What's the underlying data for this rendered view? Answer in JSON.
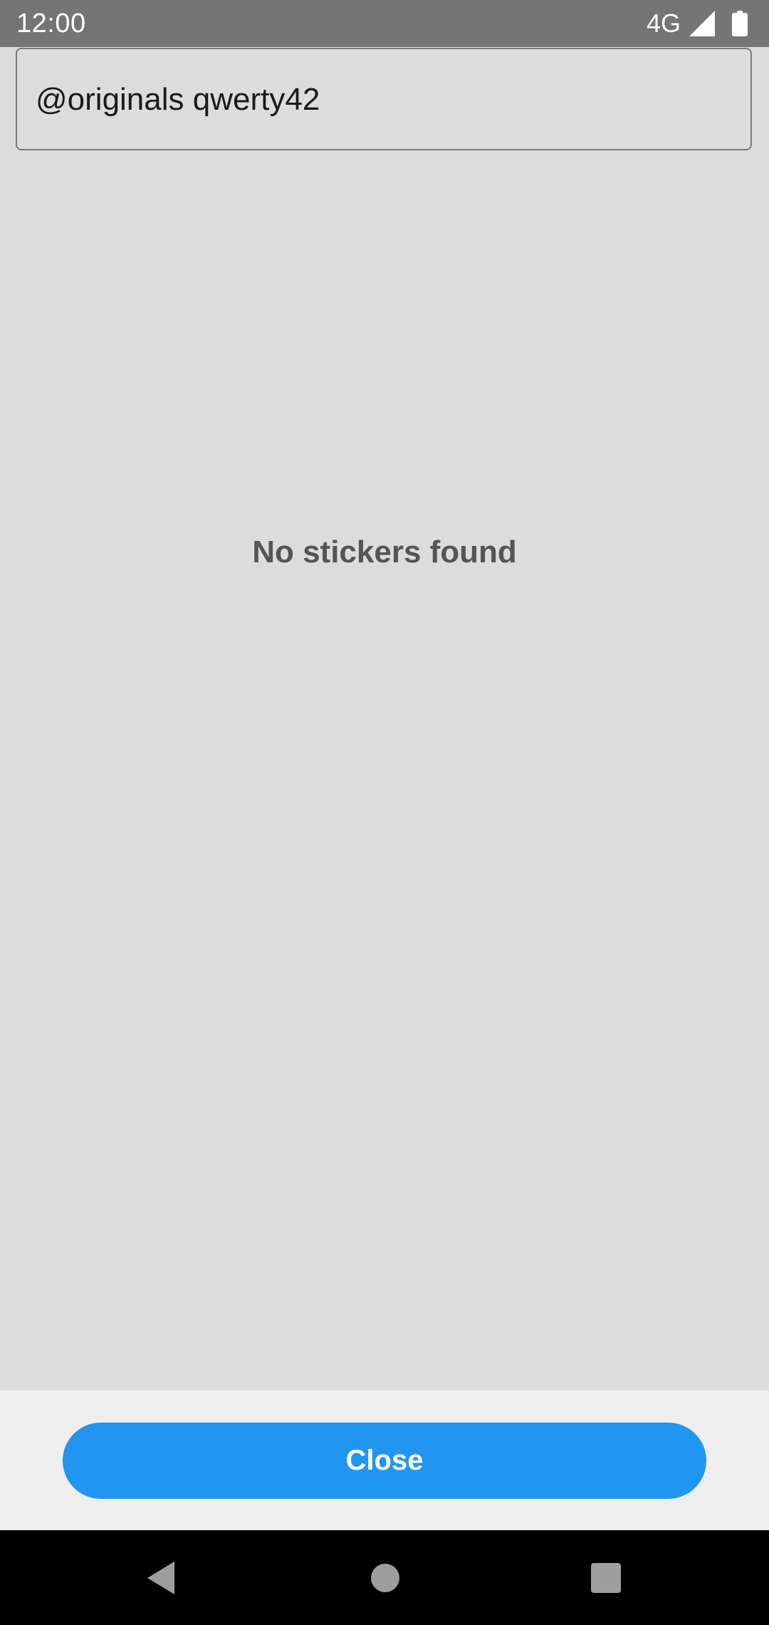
{
  "status_bar": {
    "time": "12:00",
    "network": "4G",
    "icons": [
      "signal-icon",
      "battery-icon"
    ]
  },
  "search": {
    "value": "@originals qwerty42"
  },
  "main": {
    "empty_message": "No stickers found"
  },
  "footer": {
    "close_label": "Close"
  },
  "navigation": {
    "icons": [
      "back-icon",
      "home-icon",
      "recents-icon"
    ]
  },
  "colors": {
    "status_bar": "#757575",
    "background": "#dcdcdc",
    "footer_background": "#eeeeee",
    "accent": "#2196f0",
    "nav_bar": "#000000"
  }
}
